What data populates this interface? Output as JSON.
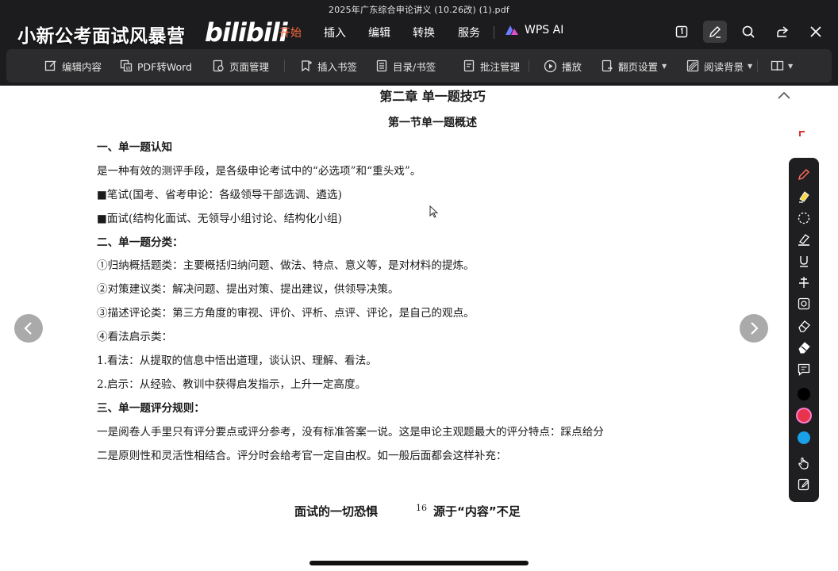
{
  "window": {
    "title": "2025年广东综合申论讲义 (10.26改) (1).pdf"
  },
  "overlay": {
    "channel_banner": "小新公考面试风暴营",
    "logo_text": "bilibili"
  },
  "menu": {
    "items": [
      "开始",
      "插入",
      "编辑",
      "转换",
      "服务"
    ],
    "active_index": 0,
    "ai_label": "WPS AI",
    "active_color": "#ff6a3d"
  },
  "top_icons": [
    "page-view-icon",
    "pen-icon",
    "search-icon",
    "share-icon",
    "close-icon"
  ],
  "toolbar": {
    "edit_content": "编辑内容",
    "pdf_to_word": "PDF转Word",
    "page_manage": "页面管理",
    "insert_bookmark": "插入书签",
    "toc_bookmark": "目录/书签",
    "annotation_manage": "批注管理",
    "play": "播放",
    "page_turn_settings": "翻页设置",
    "reading_bg": "阅读背景"
  },
  "document": {
    "chapter_title": "第二章 单一题技巧",
    "section_title": "第一节单一题概述",
    "lines": [
      "一、单一题认知",
      "是一种有效的测评手段，是各级申论考试中的“必选项”和“重头戏”。",
      "■笔试(国考、省考申论：各级领导干部选调、遴选)",
      "■面试(结构化面试、无领导小组讨论、结构化小组)",
      "二、单一题分类：",
      "①归纳概括题类：主要概括归纳问题、做法、特点、意义等，是对材料的提炼。",
      "②对策建议类：解决问题、提出对策、提出建议，供领导决策。",
      "③描述评论类：第三方角度的审视、评价、评析、点评、评论，是自己的观点。",
      "④看法启示类：",
      "1.看法：从提取的信息中悟出道理，谈认识、理解、看法。",
      "2.启示：从经验、教训中获得启发指示，上升一定高度。",
      "三、单一题评分规则：",
      "一是阅卷人手里只有评分要点或评分参考，没有标准答案一说。这是申论主观题最大的评分特点：踩点给分",
      "二是原则性和灵活性相结合。评分时会给考官一定自由权。如一般后面都会这样补充："
    ],
    "footer_left": "面试的一切恐惧",
    "page_number": "16",
    "footer_right": "源于“内容”不足"
  },
  "palette": {
    "tools": [
      "pen-icon",
      "highlighter-icon",
      "lasso-icon",
      "marker-icon",
      "underline-icon",
      "strikethrough-icon",
      "area-select-icon",
      "eraser-icon",
      "partial-eraser-icon",
      "comment-icon"
    ],
    "colors": [
      "#000000",
      "#e8344a",
      "#1aa0e8"
    ],
    "bottom_tools": [
      "hand-icon",
      "edit-note-icon"
    ]
  }
}
